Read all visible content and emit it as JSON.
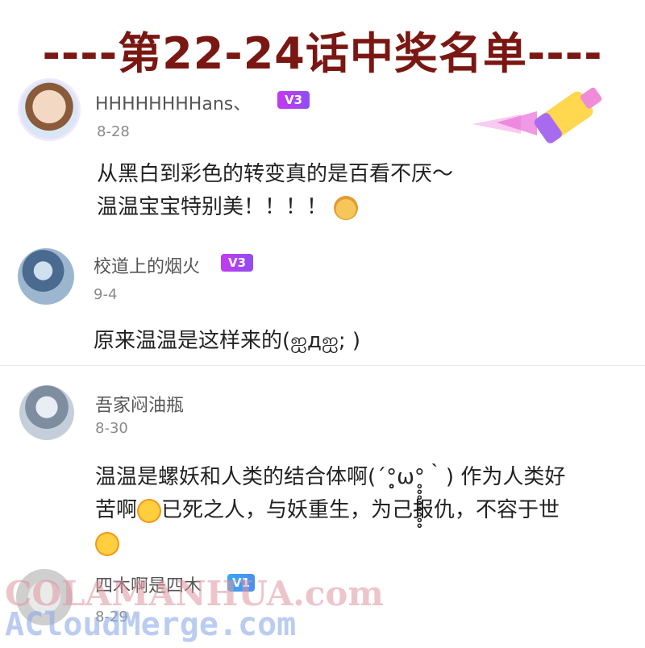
{
  "banner": {
    "title": "----第22-24话中奖名单----"
  },
  "comments": [
    {
      "username": "HHHHHHHHans、",
      "level": "V3",
      "date": "8-28",
      "lines": [
        "从黑白到彩色的转变真的是百看不厌～",
        "温温宝宝特别美！！！！"
      ]
    },
    {
      "username": "校道上的烟火",
      "level": "V3",
      "date": "9-4",
      "lines": [
        "原来温温是这样来的(ஐдஐ; )"
      ]
    },
    {
      "username": "吾家闷油瓶",
      "date": "8-30",
      "lines": [
        "温温是螺妖和人类的结合体啊(´°̥̥̥̥̥̥̥̥ω°̥̥̥̥̥̥̥̥｀) 作为人类好",
        "苦啊",
        "已死之人，与妖重生，为己报仇，不容于世"
      ]
    },
    {
      "username": "四木啊是四木",
      "level": "V1",
      "date": "8-29"
    }
  ],
  "watermark": {
    "line1": "COLAMANHUA.com",
    "line2": "ACloudMerge.com"
  },
  "colors": {
    "title": "#7a1712",
    "badge_v3": "#b044f0",
    "badge_v1": "#3b9bf2"
  },
  "icons": [
    "shiba-rose-emoji",
    "crying-emoji",
    "paint-bottle-decoration"
  ]
}
